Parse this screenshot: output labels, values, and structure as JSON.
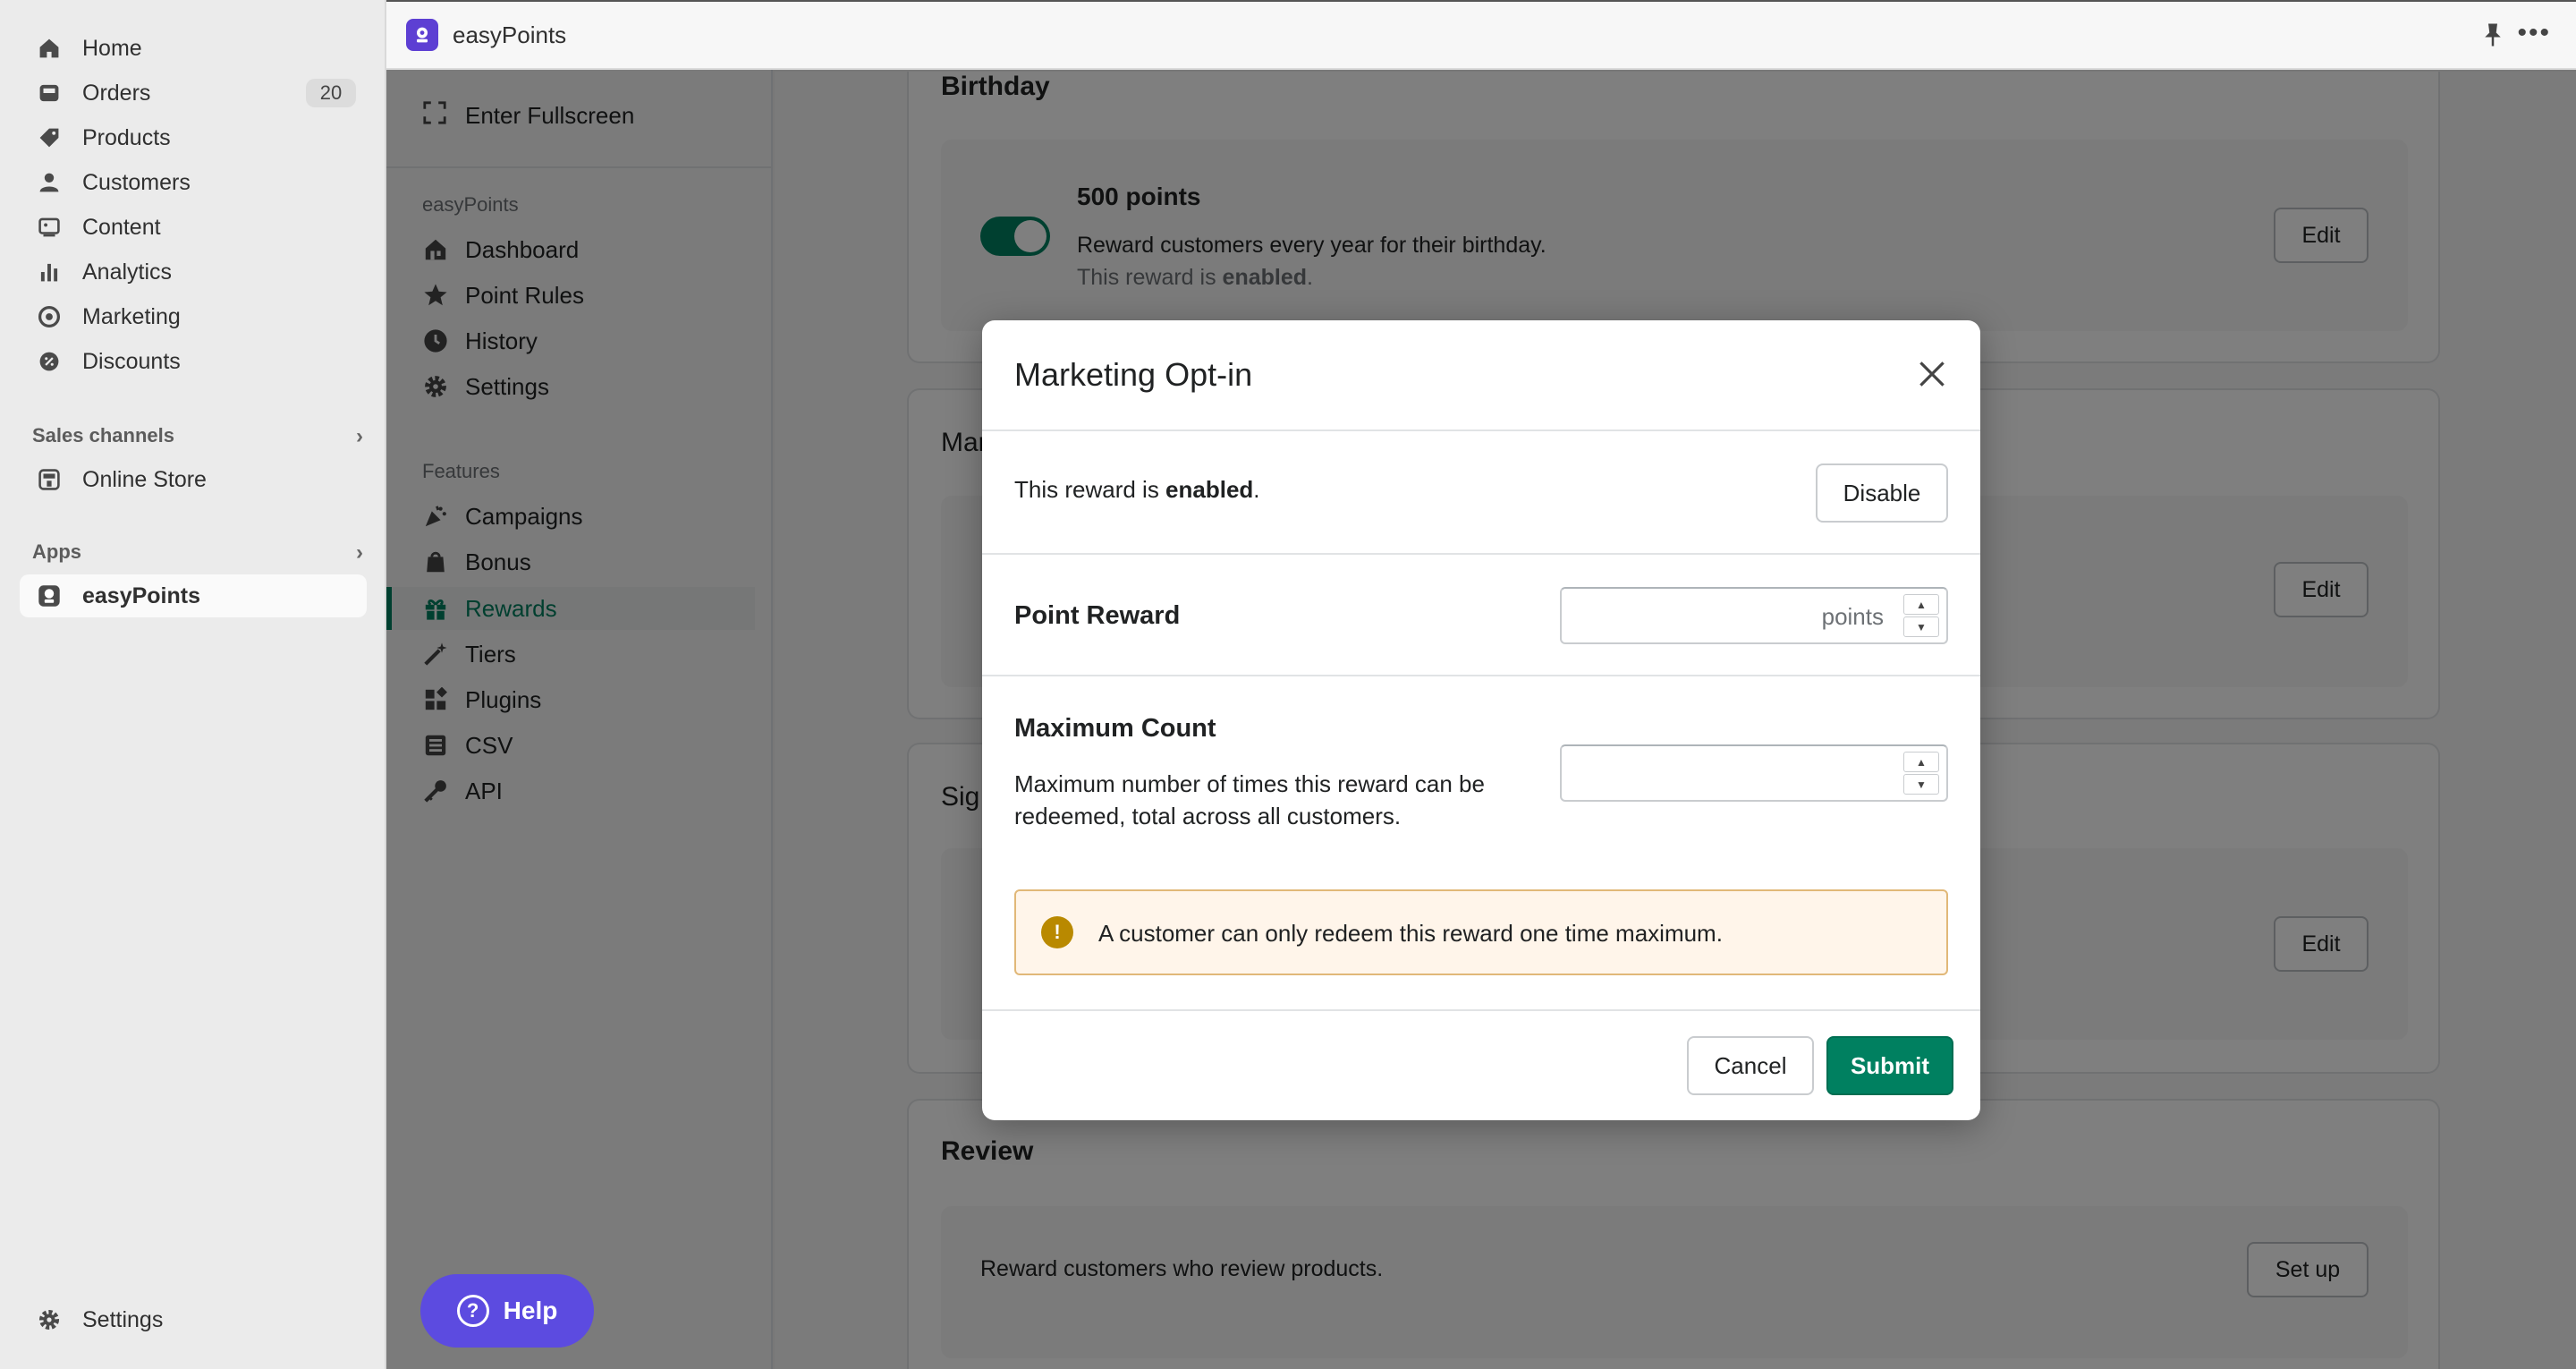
{
  "admin_nav": {
    "items": [
      {
        "label": "Home",
        "icon": "home-icon"
      },
      {
        "label": "Orders",
        "icon": "orders-icon",
        "badge": "20"
      },
      {
        "label": "Products",
        "icon": "tag-icon"
      },
      {
        "label": "Customers",
        "icon": "person-icon"
      },
      {
        "label": "Content",
        "icon": "content-icon"
      },
      {
        "label": "Analytics",
        "icon": "bar-chart-icon"
      },
      {
        "label": "Marketing",
        "icon": "target-icon"
      },
      {
        "label": "Discounts",
        "icon": "discount-icon"
      }
    ],
    "sales_channels_label": "Sales channels",
    "online_store_label": "Online Store",
    "apps_label": "Apps",
    "app_item_label": "easyPoints",
    "settings_label": "Settings"
  },
  "topbar": {
    "app_title": "easyPoints"
  },
  "app_sidebar": {
    "fullscreen_label": "Enter Fullscreen",
    "group1_label": "easyPoints",
    "group1_items": [
      "Dashboard",
      "Point Rules",
      "History",
      "Settings"
    ],
    "group2_label": "Features",
    "group2_items": [
      "Campaigns",
      "Bonus",
      "Rewards",
      "Tiers",
      "Plugins",
      "CSV",
      "API"
    ],
    "active_item": "Rewards"
  },
  "help_button": {
    "label": "Help"
  },
  "background": {
    "birthday_title": "Birthday",
    "birthday_points": "500 points",
    "birthday_desc": "Reward customers every year for their birthday.",
    "birthday_status_prefix": "This reward is ",
    "birthday_status_value": "enabled",
    "birthday_status_suffix": ".",
    "card2_title_partial": "Mar",
    "card3_title_partial": "Sig",
    "edit_label": "Edit",
    "review_title": "Review",
    "review_desc": "Reward customers who review products.",
    "setup_label": "Set up"
  },
  "modal": {
    "title": "Marketing Opt-in",
    "status_prefix": "This reward is ",
    "status_value": "enabled",
    "status_suffix": ".",
    "disable_label": "Disable",
    "point_reward_label": "Point Reward",
    "point_reward_value": "",
    "point_reward_suffix": "points",
    "max_count_label": "Maximum Count",
    "max_count_desc": "Maximum number of times this reward can be redeemed, total across all customers.",
    "max_count_value": "",
    "banner_text": "A customer can only redeem this reward one time maximum.",
    "cancel_label": "Cancel",
    "submit_label": "Submit"
  },
  "colors": {
    "primary": "#008060",
    "help": "#5c4be0",
    "warning": "#b98900",
    "banner_bg": "#fff5ea"
  }
}
